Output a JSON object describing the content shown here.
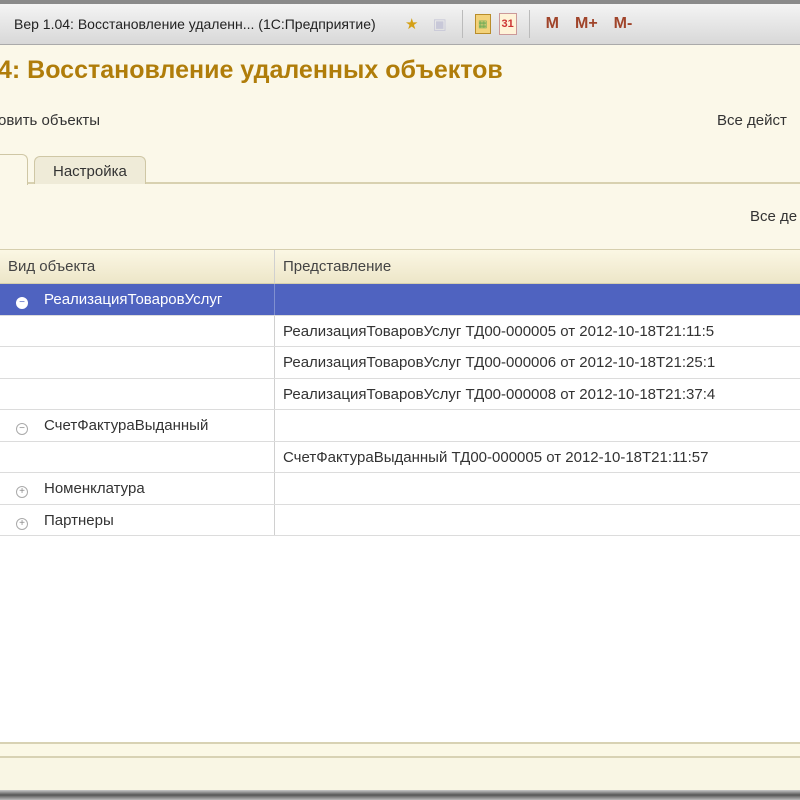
{
  "window": {
    "title": "Вер 1.04: Восстановление удаленн... (1С:Предприятие)",
    "icons": [
      "favorites-star-icon",
      "bookmark-icon",
      "calculator-icon",
      "calendar-icon"
    ],
    "calendar_day": "31",
    "memory_buttons": [
      "M",
      "M+",
      "M-"
    ]
  },
  "page_title": "4: Восстановление удаленных объектов",
  "command_bar": {
    "restore_label": "овить объекты",
    "all_actions_label": "Все дейст"
  },
  "tabs": [
    {
      "label": ""
    },
    {
      "label": "Настройка"
    }
  ],
  "inner_bar": {
    "all_actions_label": "Все де"
  },
  "table": {
    "columns": [
      "Вид объекта",
      "Представление"
    ],
    "rows": [
      {
        "kind": "РеализацияТоваровУслуг",
        "repr": "",
        "toggle": "−",
        "selected": true
      },
      {
        "kind": "",
        "repr": "РеализацияТоваровУслуг ТД00-000005 от 2012-10-18T21:11:5"
      },
      {
        "kind": "",
        "repr": "РеализацияТоваровУслуг ТД00-000006 от 2012-10-18T21:25:1"
      },
      {
        "kind": "",
        "repr": "РеализацияТоваровУслуг ТД00-000008 от 2012-10-18T21:37:4"
      },
      {
        "kind": "СчетФактураВыданный",
        "repr": "",
        "toggle": "−"
      },
      {
        "kind": "",
        "repr": "СчетФактураВыданный ТД00-000005 от 2012-10-18T21:11:57"
      },
      {
        "kind": "Номенклатура",
        "repr": "",
        "toggle": "+"
      },
      {
        "kind": "Партнеры",
        "repr": "",
        "toggle": "+"
      }
    ]
  }
}
